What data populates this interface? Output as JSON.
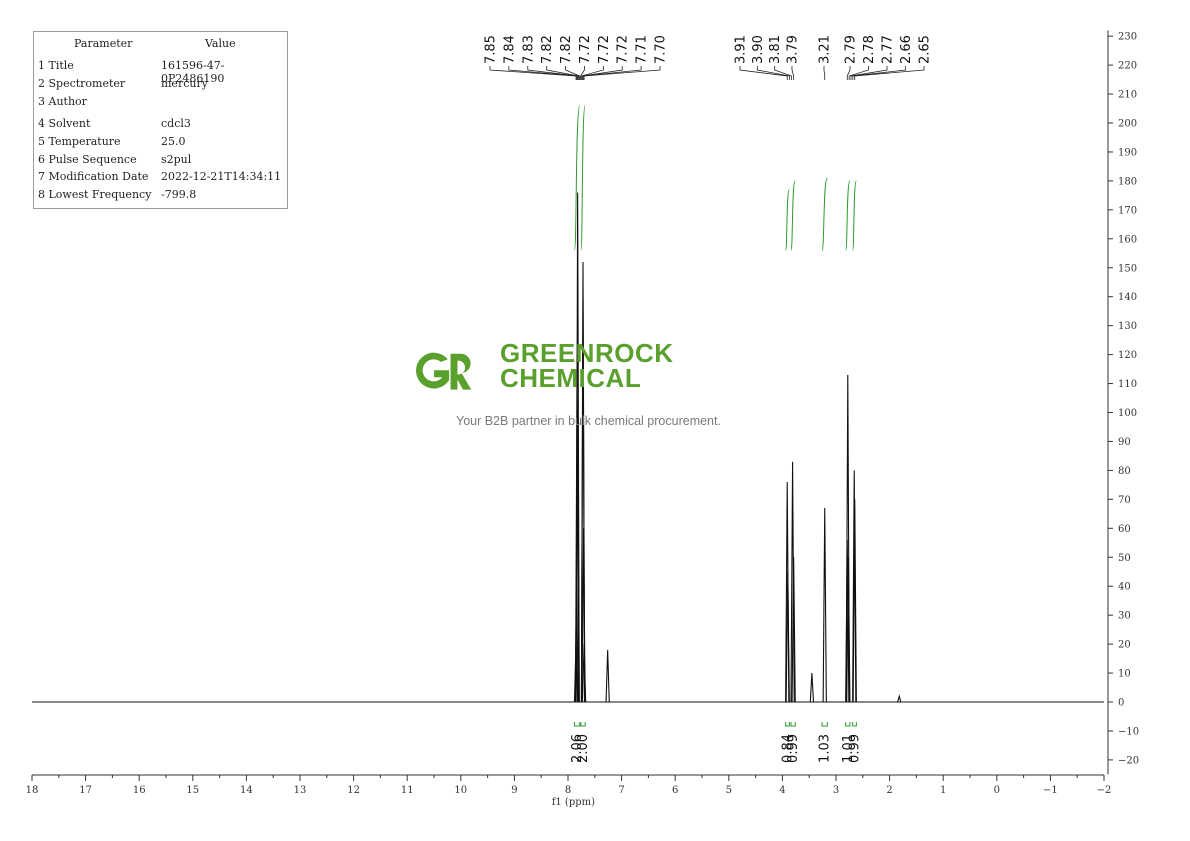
{
  "parameters": {
    "header_param": "Parameter",
    "header_value": "Value",
    "rows": [
      {
        "label": "1 Title",
        "value": "161596-47-0P2486190"
      },
      {
        "label": "2 Spectrometer",
        "value": "mercury"
      },
      {
        "label": "3 Author",
        "value": ""
      },
      {
        "label": "4 Solvent",
        "value": "cdcl3"
      },
      {
        "label": "5 Temperature",
        "value": "25.0"
      },
      {
        "label": "6 Pulse Sequence",
        "value": "s2pul"
      },
      {
        "label": "7 Modification Date",
        "value": "2022-12-21T14:34:11"
      },
      {
        "label": "8 Lowest Frequency",
        "value": "-799.8"
      }
    ]
  },
  "watermark": {
    "line1": "GREENROCK",
    "line2": "CHEMICAL",
    "tagline": "Your B2B partner in bulk chemical procurement.",
    "color": "#5aa02c"
  },
  "chart_data": {
    "type": "line",
    "title": "",
    "xlabel": "f1 (ppm)",
    "ylabel": "",
    "xlim": [
      18,
      -2
    ],
    "ylim": [
      -25,
      232
    ],
    "x_ticks": [
      18,
      17,
      16,
      15,
      14,
      13,
      12,
      11,
      10,
      9,
      8,
      7,
      6,
      5,
      4,
      3,
      2,
      1,
      0,
      -1,
      -2
    ],
    "x_tick_labels": [
      "18",
      "17",
      "16",
      "15",
      "14",
      "13",
      "12",
      "11",
      "10",
      "9",
      "8",
      "7",
      "6",
      "5",
      "4",
      "3",
      "2",
      "1",
      "0",
      "−1",
      "−2"
    ],
    "y_ticks": [
      230,
      220,
      210,
      200,
      190,
      180,
      170,
      160,
      150,
      140,
      130,
      120,
      110,
      100,
      90,
      80,
      70,
      60,
      50,
      40,
      30,
      20,
      10,
      0,
      -10,
      -20
    ],
    "y_tick_labels": [
      "230",
      "220",
      "210",
      "200",
      "190",
      "180",
      "170",
      "160",
      "150",
      "140",
      "130",
      "120",
      "110",
      "100",
      "90",
      "80",
      "70",
      "60",
      "50",
      "40",
      "30",
      "20",
      "10",
      "0",
      "−10",
      "−20"
    ],
    "y_axis_side": "right",
    "grid": false,
    "peaks": [
      {
        "ppm": 7.85,
        "height": 20
      },
      {
        "ppm": 7.84,
        "height": 40
      },
      {
        "ppm": 7.83,
        "height": 120
      },
      {
        "ppm": 7.82,
        "height": 176
      },
      {
        "ppm": 7.82,
        "height": 100
      },
      {
        "ppm": 7.72,
        "height": 152
      },
      {
        "ppm": 7.72,
        "height": 139
      },
      {
        "ppm": 7.71,
        "height": 60
      },
      {
        "ppm": 7.7,
        "height": 20
      },
      {
        "ppm": 7.26,
        "height": 18
      },
      {
        "ppm": 3.91,
        "height": 76
      },
      {
        "ppm": 3.9,
        "height": 45
      },
      {
        "ppm": 3.81,
        "height": 83
      },
      {
        "ppm": 3.79,
        "height": 50
      },
      {
        "ppm": 3.45,
        "height": 10
      },
      {
        "ppm": 3.21,
        "height": 67
      },
      {
        "ppm": 2.79,
        "height": 56
      },
      {
        "ppm": 2.78,
        "height": 113
      },
      {
        "ppm": 2.77,
        "height": 50
      },
      {
        "ppm": 2.66,
        "height": 80
      },
      {
        "ppm": 2.65,
        "height": 70
      },
      {
        "ppm": 1.82,
        "height": 2
      }
    ],
    "peak_labels": {
      "group1": [
        "7.85",
        "7.84",
        "7.83",
        "7.82",
        "7.82",
        "7.72",
        "7.72",
        "7.72",
        "7.71",
        "7.70"
      ],
      "group2": [
        "3.91",
        "3.90",
        "3.81",
        "3.79"
      ],
      "group3": [
        "3.21"
      ],
      "group4": [
        "2.79",
        "2.78",
        "2.77",
        "2.66",
        "2.65"
      ]
    },
    "integrals": [
      {
        "from": 7.88,
        "to": 7.78,
        "value": "2.06",
        "curve_low": 156,
        "curve_high": 206
      },
      {
        "from": 7.76,
        "to": 7.68,
        "value": "2.00",
        "curve_low": 156,
        "curve_high": 206
      },
      {
        "from": 3.94,
        "to": 3.87,
        "value": "0.84",
        "curve_low": 156,
        "curve_high": 177
      },
      {
        "from": 3.84,
        "to": 3.76,
        "value": "0.99",
        "curve_low": 156,
        "curve_high": 180
      },
      {
        "from": 3.26,
        "to": 3.16,
        "value": "1.03",
        "curve_low": 156,
        "curve_high": 181
      },
      {
        "from": 2.82,
        "to": 2.74,
        "value": "1.01",
        "curve_low": 156,
        "curve_high": 180
      },
      {
        "from": 2.69,
        "to": 2.62,
        "value": "0.99",
        "curve_low": 156,
        "curve_high": 180
      }
    ],
    "integral_color": "#2e9a2e"
  }
}
